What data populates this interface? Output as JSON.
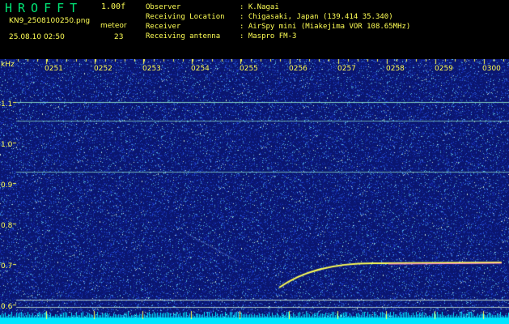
{
  "header": {
    "logo": "HROFFT",
    "version": "1.00f",
    "filename": "KN9_2508100250.png",
    "meteor_label": "meteor",
    "datetime": "25.08.10 02:50",
    "meteor_count": "23",
    "info": [
      {
        "key": "Observer",
        "value": ": K.Nagai"
      },
      {
        "key": "Receiving Location",
        "value": ": Chigasaki, Japan (139.414 35.340)"
      },
      {
        "key": "Receiver",
        "value": ": AirSpy mini (Miakejima VOR 108.65MHz)"
      },
      {
        "key": "Receiving antenna",
        "value": ": Maspro FM-3"
      }
    ]
  },
  "spectrogram": {
    "unit": "kHz",
    "time_labels": [
      "0251",
      "0252",
      "0253",
      "0254",
      "0255",
      "0256",
      "0257",
      "0258",
      "0259",
      "0300"
    ],
    "freq_labels": [
      "1.1",
      "1.0",
      "0.9",
      "0.8",
      "0.7",
      "0.6"
    ],
    "background_color": "#0a1670",
    "trace_color": "#ffff55"
  }
}
